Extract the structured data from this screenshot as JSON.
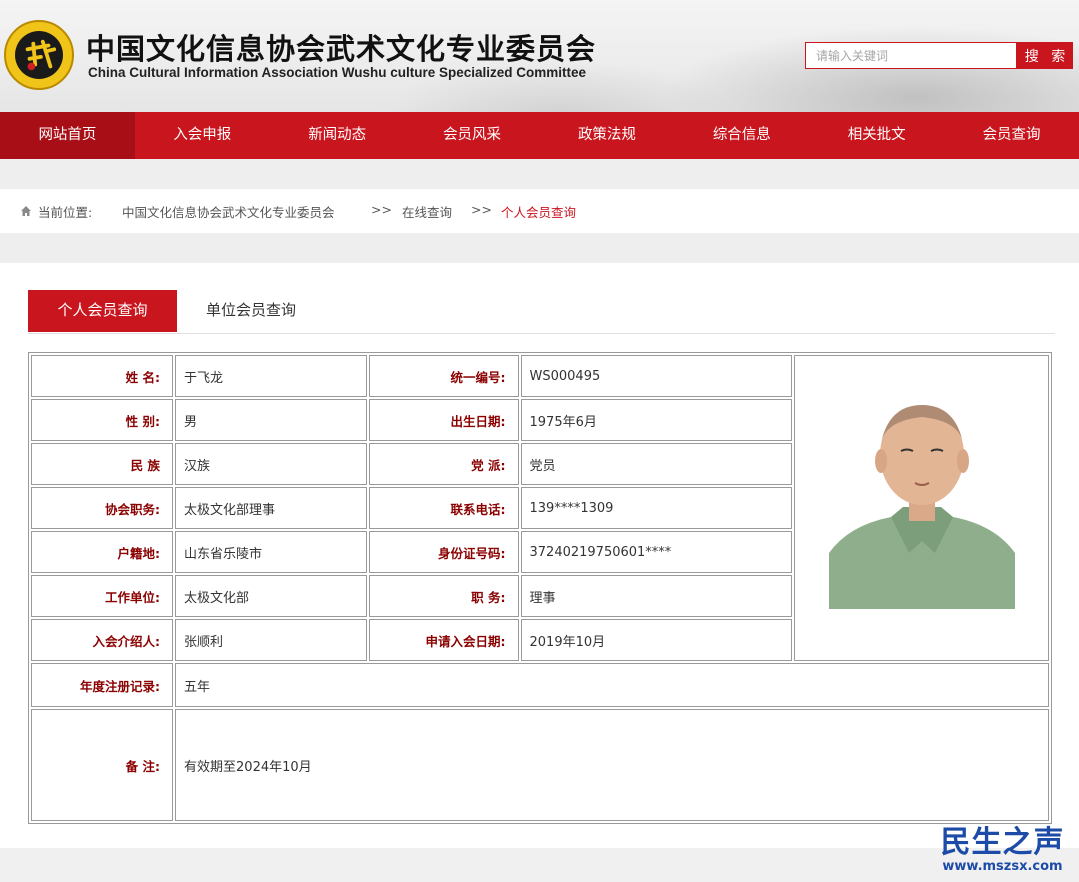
{
  "header": {
    "title_cn": "中国文化信息协会武术文化专业委员会",
    "title_en": "China Cultural Information Association Wushu culture Specialized Committee",
    "search_placeholder": "请输入关键词",
    "search_button": "搜 索"
  },
  "nav": {
    "items": [
      {
        "label": "网站首页"
      },
      {
        "label": "入会申报"
      },
      {
        "label": "新闻动态"
      },
      {
        "label": "会员风采"
      },
      {
        "label": "政策法规"
      },
      {
        "label": "综合信息"
      },
      {
        "label": "相关批文"
      },
      {
        "label": "会员查询"
      }
    ]
  },
  "breadcrumb": {
    "label": "当前位置:",
    "items": [
      "中国文化信息协会武术文化专业委员会",
      "在线查询",
      "个人会员查询"
    ],
    "separator": ">>"
  },
  "tabs": [
    {
      "label": "个人会员查询"
    },
    {
      "label": "单位会员查询"
    }
  ],
  "member": {
    "name_label": "姓 名:",
    "name": "于飞龙",
    "code_label": "统一编号:",
    "code": "WS000495",
    "gender_label": "性 别:",
    "gender": "男",
    "birth_label": "出生日期:",
    "birth": "1975年6月",
    "ethnic_label": "民 族",
    "ethnic": "汉族",
    "party_label": "党 派:",
    "party": "党员",
    "assoc_role_label": "协会职务:",
    "assoc_role": "太极文化部理事",
    "phone_label": "联系电话:",
    "phone": "139****1309",
    "hukou_label": "户籍地:",
    "hukou": "山东省乐陵市",
    "idcard_label": "身份证号码:",
    "idcard": "37240219750601****",
    "work_label": "工作单位:",
    "work": "太极文化部",
    "title_label": "职 务:",
    "title": "理事",
    "introducer_label": "入会介绍人:",
    "introducer": "张顺利",
    "apply_date_label": "申请入会日期:",
    "apply_date": "2019年10月",
    "annual_label": "年度注册记录:",
    "annual": "五年",
    "remark_label": "备 注:",
    "remark": "有效期至2024年10月"
  },
  "watermark": {
    "title": "民生之声",
    "url": "www.mszsx.com"
  },
  "colors": {
    "brand_red": "#c9151e",
    "nav_active": "#a80e16",
    "label_red": "#8b0000",
    "watermark_blue": "#1c4ba8"
  }
}
